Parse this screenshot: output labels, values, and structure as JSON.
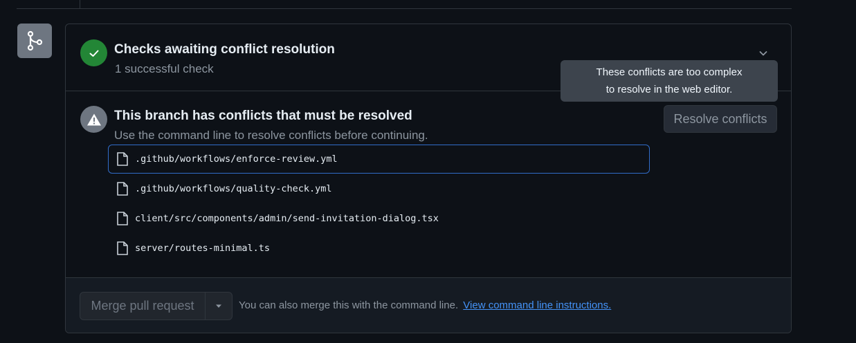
{
  "checks": {
    "title": "Checks awaiting conflict resolution",
    "subtitle": "1 successful check",
    "status_color": "#238636"
  },
  "tooltip": {
    "line1": "These conflicts are too complex",
    "line2": "to resolve in the web editor."
  },
  "conflicts": {
    "title": "This branch has conflicts that must be resolved",
    "subtitle": "Use the command line to resolve conflicts before continuing.",
    "resolve_button": "Resolve conflicts",
    "files": [
      ".github/workflows/enforce-review.yml",
      ".github/workflows/quality-check.yml",
      "client/src/components/admin/send-invitation-dialog.tsx",
      "server/routes-minimal.ts"
    ]
  },
  "merge": {
    "button_label": "Merge pull request",
    "text": "You can also merge this with the command line.",
    "link": "View command line instructions."
  },
  "icons": {
    "badge": "git-merge-icon",
    "check": "check-icon",
    "warning": "alert-icon",
    "file": "file-icon",
    "chevron": "chevron-down-icon",
    "dropdown": "triangle-down-icon"
  },
  "colors": {
    "accent_link": "#4493f8",
    "selected_border": "#316dca"
  }
}
